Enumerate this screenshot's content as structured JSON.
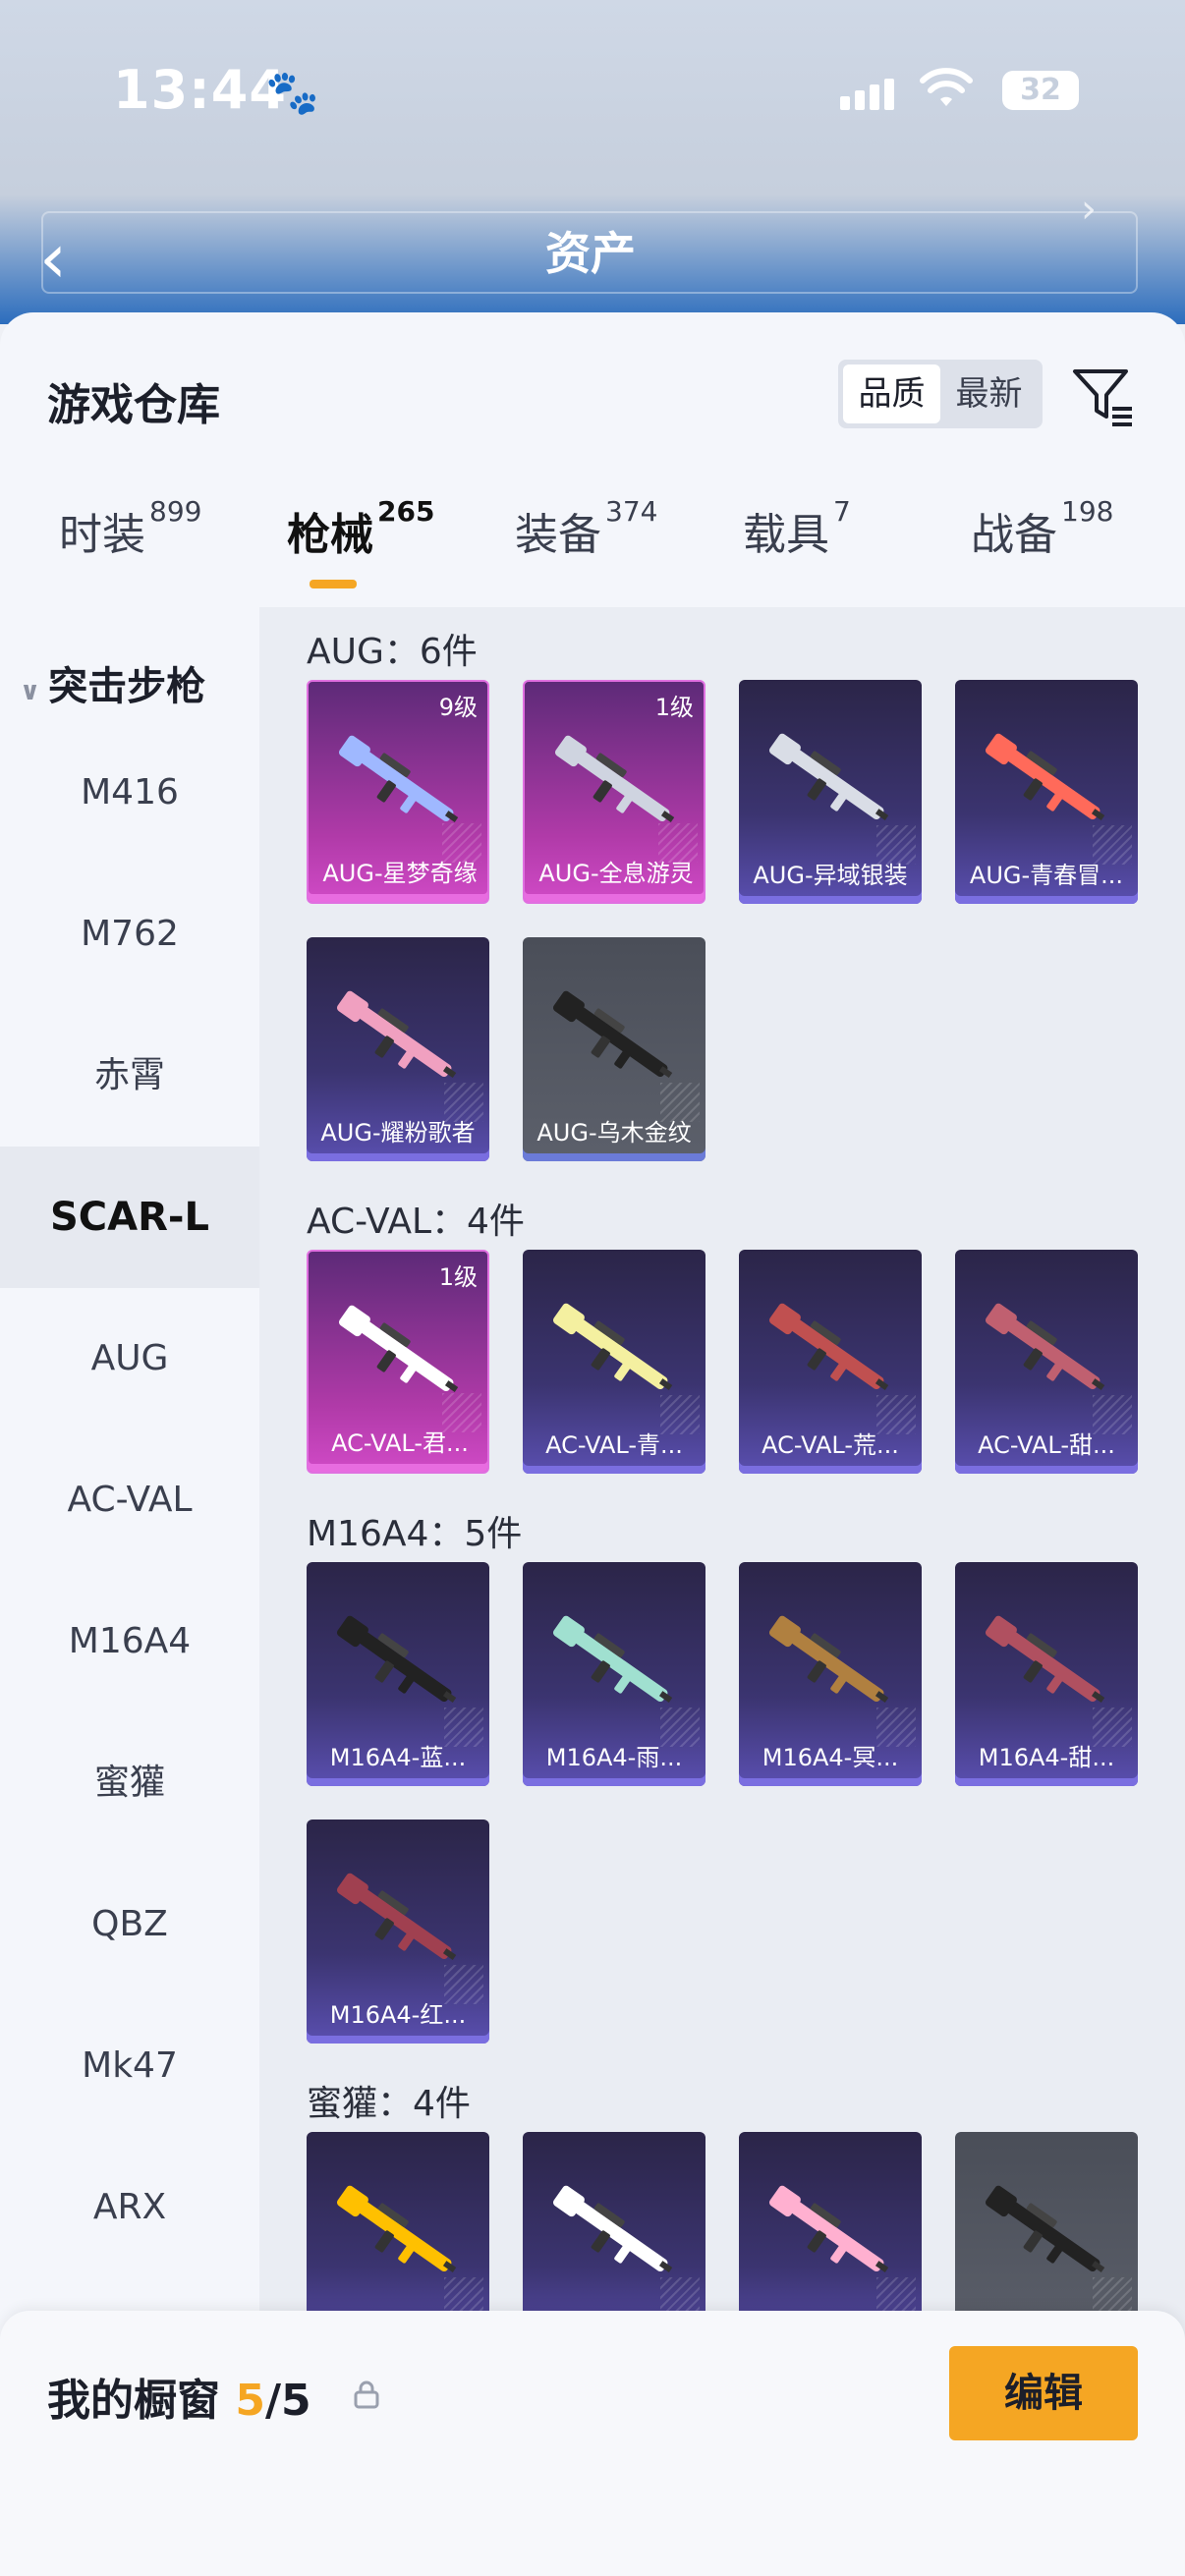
{
  "status_bar": {
    "time": "13:44",
    "battery": "32"
  },
  "header": {
    "title": "资产"
  },
  "sheet": {
    "title": "游戏仓库",
    "sort_options": [
      "品质",
      "最新"
    ],
    "selected_sort": "品质"
  },
  "tabs": [
    {
      "label": "时装",
      "count": "899"
    },
    {
      "label": "枪械",
      "count": "265",
      "active": true
    },
    {
      "label": "装备",
      "count": "374"
    },
    {
      "label": "载具",
      "count": "7"
    },
    {
      "label": "战备",
      "count": "198"
    }
  ],
  "sidebar": {
    "category": "突击步枪",
    "items": [
      "M416",
      "M762",
      "赤霄",
      "SCAR-L",
      "AUG",
      "AC-VAL",
      "M16A4",
      "蜜獾",
      "QBZ",
      "Mk47",
      "ARX"
    ],
    "active_item": "SCAR-L"
  },
  "groups": [
    {
      "title": "AUG：6件",
      "items": [
        {
          "name": "AUG-星梦奇缘",
          "level": "9级",
          "rarity": "pink"
        },
        {
          "name": "AUG-全息游灵",
          "level": "1级",
          "rarity": "pink"
        },
        {
          "name": "AUG-异域银装",
          "level": "",
          "rarity": "purple"
        },
        {
          "name": "AUG-青春冒...",
          "level": "",
          "rarity": "purple"
        },
        {
          "name": "AUG-耀粉歌者",
          "level": "",
          "rarity": "purple"
        },
        {
          "name": "AUG-乌木金纹",
          "level": "",
          "rarity": "gray"
        }
      ]
    },
    {
      "title": "AC-VAL：4件",
      "items": [
        {
          "name": "AC-VAL-君...",
          "level": "1级",
          "rarity": "pink"
        },
        {
          "name": "AC-VAL-青...",
          "level": "",
          "rarity": "purple"
        },
        {
          "name": "AC-VAL-荒...",
          "level": "",
          "rarity": "purple"
        },
        {
          "name": "AC-VAL-甜...",
          "level": "",
          "rarity": "purple"
        }
      ]
    },
    {
      "title": "M16A4：5件",
      "items": [
        {
          "name": "M16A4-蓝...",
          "level": "",
          "rarity": "purple"
        },
        {
          "name": "M16A4-雨...",
          "level": "",
          "rarity": "purple"
        },
        {
          "name": "M16A4-冥...",
          "level": "",
          "rarity": "purple"
        },
        {
          "name": "M16A4-甜...",
          "level": "",
          "rarity": "purple"
        },
        {
          "name": "M16A4-红...",
          "level": "",
          "rarity": "purple"
        }
      ]
    },
    {
      "title": "蜜獾：4件",
      "items": [
        {
          "name": "",
          "level": "",
          "rarity": "purple"
        },
        {
          "name": "",
          "level": "",
          "rarity": "purple"
        },
        {
          "name": "",
          "level": "",
          "rarity": "purple"
        },
        {
          "name": "",
          "level": "",
          "rarity": "gray"
        }
      ]
    }
  ],
  "showcase": {
    "label": "我的橱窗",
    "count": "5",
    "total": "/5",
    "edit_label": "编辑"
  },
  "colors": {
    "accent": "#f5a623",
    "rare_pink": "#c43fbf",
    "rare_purple": "#4a40a0"
  }
}
